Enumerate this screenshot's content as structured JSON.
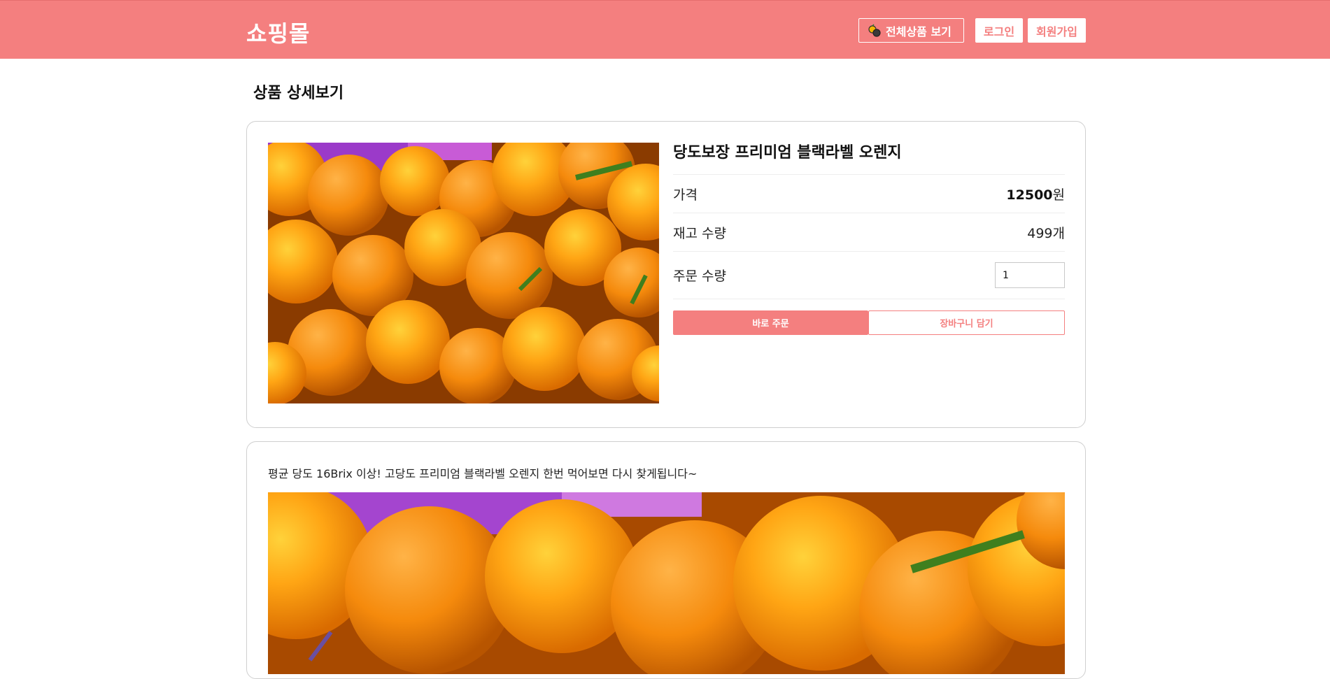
{
  "header": {
    "brand": "쇼핑몰",
    "all_products_label": "전체상품 보기",
    "login_label": "로그인",
    "signup_label": "회원가입"
  },
  "page": {
    "title": "상품 상세보기"
  },
  "product": {
    "name": "당도보장 프리미엄 블랙라벨 오렌지",
    "price_label": "가격",
    "price_value": "12500",
    "price_unit": "원",
    "stock_label": "재고 수량",
    "stock_value": "499개",
    "qty_label": "주문 수량",
    "qty_value": "1",
    "order_button": "바로 주문",
    "cart_button": "장바구니 담기",
    "image_icon": "oranges-photo"
  },
  "description": {
    "text": "평균 당도 16Brix 이상! 고당도 프리미엄 블랙라벨 오렌지 한번 먹어보면 다시 찾게됩니다~",
    "image_icon": "oranges-closeup-photo"
  },
  "colors": {
    "accent": "#f47f7f",
    "border": "#cfcfcf"
  }
}
